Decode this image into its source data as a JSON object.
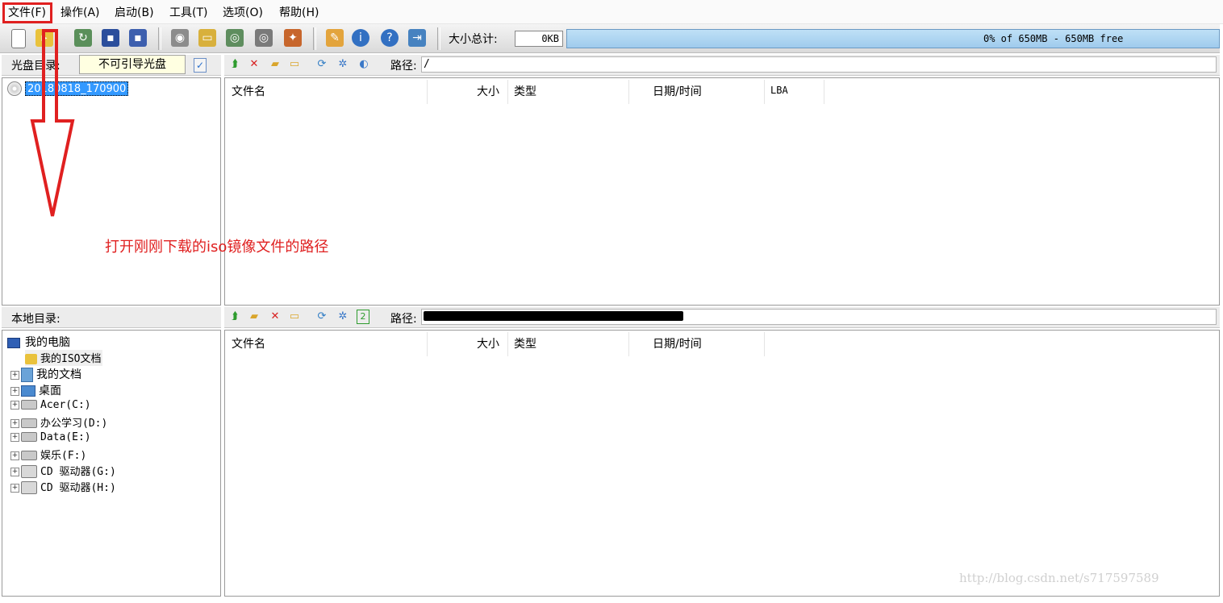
{
  "menu": {
    "items": [
      "文件(F)",
      "操作(A)",
      "启动(B)",
      "工具(T)",
      "选项(O)",
      "帮助(H)"
    ]
  },
  "toolbar": {
    "size_label": "大小总计:",
    "size_value": "0KB",
    "capacity_text": "0% of 650MB - 650MB free",
    "capacity_fraction": 0.0
  },
  "disc_panel": {
    "title": "光盘目录:",
    "boot_status": "不可引导光盘",
    "path_label": "路径:",
    "path_value": "/",
    "tree_root": "20180818_170900",
    "columns": [
      "文件名",
      "大小",
      "类型",
      "日期/时间",
      "LBA"
    ]
  },
  "local_panel": {
    "title": "本地目录:",
    "path_label": "路径:",
    "columns": [
      "文件名",
      "大小",
      "类型",
      "日期/时间"
    ],
    "tree": [
      {
        "label": "我的电脑",
        "icon": "computer-icon"
      },
      {
        "label": "我的ISO文档",
        "icon": "iso-folder-icon"
      },
      {
        "label": "我的文档",
        "icon": "documents-icon"
      },
      {
        "label": "桌面",
        "icon": "desktop-icon"
      },
      {
        "label": "Acer(C:)",
        "icon": "drive-icon"
      },
      {
        "label": "办公学习(D:)",
        "icon": "drive-icon"
      },
      {
        "label": "Data(E:)",
        "icon": "drive-icon"
      },
      {
        "label": "娱乐(F:)",
        "icon": "drive-icon"
      },
      {
        "label": "CD 驱动器(G:)",
        "icon": "cd-drive-icon"
      },
      {
        "label": "CD 驱动器(H:)",
        "icon": "cd-drive-icon"
      }
    ]
  },
  "annotation": {
    "text": "打开刚刚下载的iso镜像文件的路径",
    "color": "#e02020"
  },
  "watermark": "http://blog.csdn.net/s717597589",
  "colors": {
    "accent_red": "#e02020",
    "capacity_bar": "#a9d3f2",
    "selection": "#3399ff"
  }
}
